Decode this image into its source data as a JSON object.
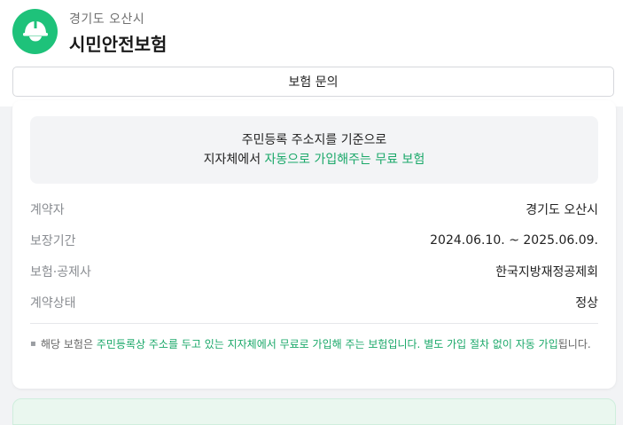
{
  "header": {
    "org_name": "경기도 오산시",
    "title": "시민안전보험",
    "logo_icon": "helmet-icon",
    "logo_color": "#1ec27a"
  },
  "inquiry_button": {
    "label": "보험 문의"
  },
  "summary": {
    "line1": "주민등록 주소지를 기준으로",
    "line2_prefix": "지자체에서 ",
    "line2_highlight": "자동으로 가입해주는 무료 보험",
    "accent_color": "#1aa869"
  },
  "details": [
    {
      "label": "계약자",
      "value": "경기도 오산시"
    },
    {
      "label": "보장기간",
      "value": "2024.06.10. ~ 2025.06.09."
    },
    {
      "label": "보험·공제사",
      "value": "한국지방재정공제회"
    },
    {
      "label": "계약상태",
      "value": "정상"
    }
  ],
  "note": {
    "prefix": "해당 보험은 ",
    "highlight": "주민등록상 주소를 두고 있는 지자체에서 무료로 가입해 주는 보험입니다. 별도 가입 절차 없이 자동 가입",
    "suffix": "됩니다."
  }
}
